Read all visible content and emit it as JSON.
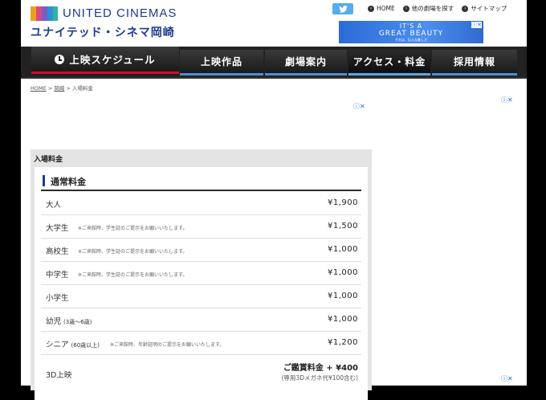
{
  "brand": {
    "logo_text": "UNITED CINEMAS",
    "theater_name": "ユナイテッド・シネマ岡崎",
    "logo_colors": [
      "#e8a21e",
      "#d64a84",
      "#7a5cc7",
      "#2f8fd6",
      "#34b3a0"
    ]
  },
  "header": {
    "twitter_icon": "twitter-icon",
    "links": [
      {
        "label": "HOME"
      },
      {
        "label": "他の劇場を探す"
      },
      {
        "label": "サイトマップ"
      }
    ],
    "ad": {
      "line1": "IT'S A",
      "line2": "GREAT BEAUTY",
      "line3": "それは、伝えな美しさ"
    }
  },
  "nav": {
    "items": [
      {
        "label": "上映スケジュール"
      },
      {
        "label": "上映作品"
      },
      {
        "label": "劇場案内"
      },
      {
        "label": "アクセス・料金"
      },
      {
        "label": "採用情報"
      }
    ],
    "active_index": 3
  },
  "breadcrumb": {
    "home": "HOME",
    "sep1": " > ",
    "mid": "岡崎",
    "sep2": " > ",
    "current": "入場料金"
  },
  "panel": {
    "title": "入場料金",
    "section_title": "通常料金",
    "rows": [
      {
        "label": "大人",
        "small": "",
        "note": "",
        "price": "¥1,900"
      },
      {
        "label": "大学生",
        "small": "",
        "note": "※ご来館時、学生証のご提示をお願いいたします。",
        "price": "¥1,500"
      },
      {
        "label": "高校生",
        "small": "",
        "note": "※ご来館時、学生証のご提示をお願いいたします。",
        "price": "¥1,000"
      },
      {
        "label": "中学生",
        "small": "",
        "note": "※ご来館時、学生証のご提示をお願いいたします。",
        "price": "¥1,000"
      },
      {
        "label": "小学生",
        "small": "",
        "note": "",
        "price": "¥1,000"
      },
      {
        "label": "幼児",
        "small": "(3歳～6歳)",
        "note": "",
        "price": "¥1,000"
      },
      {
        "label": "シニア",
        "small": "(60歳以上)",
        "note": "※ご来館時、年齢証明のご提示をお願いいたします。",
        "price": "¥1,200"
      }
    ],
    "row_3d": {
      "label": "3D上映",
      "price": "ご鑑賞料金 + ¥400",
      "sub": "(専用3Dメガネ代¥100含む)"
    }
  }
}
